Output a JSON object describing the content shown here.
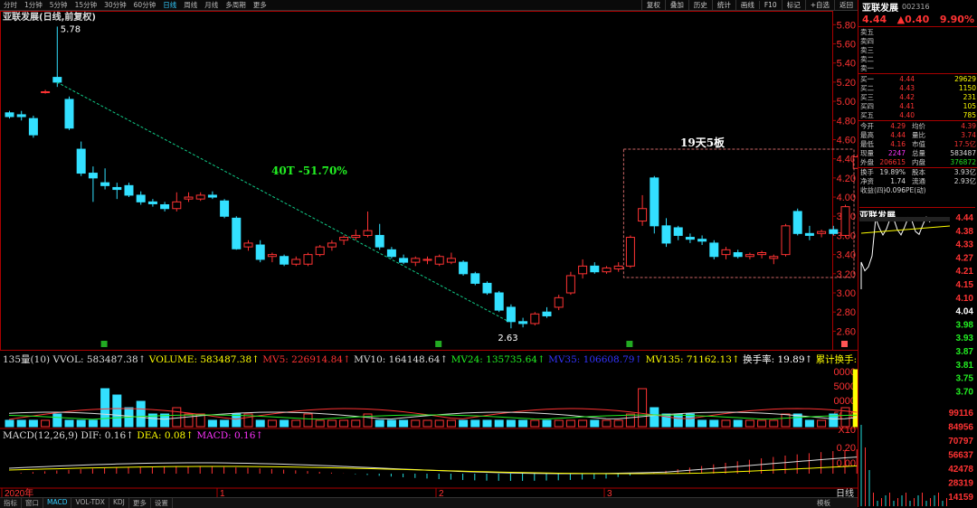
{
  "toolbar": {
    "timeframes": [
      "分时",
      "1分钟",
      "5分钟",
      "15分钟",
      "30分钟",
      "60分钟",
      "日线",
      "周线",
      "月线",
      "多周期",
      "更多"
    ],
    "active": "日线",
    "right_buttons": [
      "复权",
      "叠加",
      "历史",
      "统计",
      "画线",
      "F10",
      "标记",
      "+自选",
      "返回"
    ]
  },
  "chart_title": "亚联发展(日线,前复权)",
  "colors": {
    "up": "#ff3333",
    "down": "#33e0ff",
    "grid": "#551111",
    "axis": "#aa0000"
  },
  "annotations": {
    "high": "5.78",
    "low": "2.63",
    "trend": "40T -51.70%",
    "box": "19天5板"
  },
  "price_axis": {
    "ticks": [
      "5.80",
      "5.60",
      "5.40",
      "5.20",
      "5.00",
      "4.80",
      "4.60",
      "4.40",
      "4.20",
      "4.00",
      "3.80",
      "3.60",
      "3.40",
      "3.20",
      "3.00",
      "2.80",
      "2.60"
    ]
  },
  "chart_data": {
    "type": "candlestick",
    "ylim": [
      2.5,
      5.85
    ],
    "candles": [
      {
        "o": 4.88,
        "h": 4.9,
        "l": 4.82,
        "c": 4.84
      },
      {
        "o": 4.86,
        "h": 4.9,
        "l": 4.8,
        "c": 4.84
      },
      {
        "o": 4.82,
        "h": 4.85,
        "l": 4.62,
        "c": 4.65
      },
      {
        "o": 5.1,
        "h": 5.12,
        "l": 5.08,
        "c": 5.1
      },
      {
        "o": 5.25,
        "h": 5.78,
        "l": 5.15,
        "c": 5.2
      },
      {
        "o": 5.02,
        "h": 5.05,
        "l": 4.7,
        "c": 4.72
      },
      {
        "o": 4.5,
        "h": 4.58,
        "l": 4.22,
        "c": 4.25
      },
      {
        "o": 4.25,
        "h": 4.32,
        "l": 3.95,
        "c": 4.2
      },
      {
        "o": 4.15,
        "h": 4.3,
        "l": 4.08,
        "c": 4.12
      },
      {
        "o": 4.1,
        "h": 4.15,
        "l": 3.98,
        "c": 4.08
      },
      {
        "o": 4.12,
        "h": 4.15,
        "l": 4.0,
        "c": 4.02
      },
      {
        "o": 4.02,
        "h": 4.06,
        "l": 3.92,
        "c": 3.95
      },
      {
        "o": 3.95,
        "h": 3.98,
        "l": 3.9,
        "c": 3.93
      },
      {
        "o": 3.92,
        "h": 3.95,
        "l": 3.85,
        "c": 3.88
      },
      {
        "o": 3.88,
        "h": 4.05,
        "l": 3.85,
        "c": 3.95
      },
      {
        "o": 3.98,
        "h": 4.05,
        "l": 3.95,
        "c": 4.0
      },
      {
        "o": 3.98,
        "h": 4.05,
        "l": 3.96,
        "c": 4.02
      },
      {
        "o": 4.02,
        "h": 4.06,
        "l": 3.98,
        "c": 4.0
      },
      {
        "o": 3.96,
        "h": 3.98,
        "l": 3.78,
        "c": 3.8
      },
      {
        "o": 3.78,
        "h": 3.8,
        "l": 3.45,
        "c": 3.46
      },
      {
        "o": 3.48,
        "h": 3.55,
        "l": 3.44,
        "c": 3.52
      },
      {
        "o": 3.5,
        "h": 3.55,
        "l": 3.32,
        "c": 3.35
      },
      {
        "o": 3.38,
        "h": 3.42,
        "l": 3.32,
        "c": 3.4
      },
      {
        "o": 3.38,
        "h": 3.4,
        "l": 3.28,
        "c": 3.3
      },
      {
        "o": 3.3,
        "h": 3.38,
        "l": 3.28,
        "c": 3.35
      },
      {
        "o": 3.3,
        "h": 3.42,
        "l": 3.28,
        "c": 3.4
      },
      {
        "o": 3.4,
        "h": 3.5,
        "l": 3.38,
        "c": 3.48
      },
      {
        "o": 3.48,
        "h": 3.55,
        "l": 3.44,
        "c": 3.52
      },
      {
        "o": 3.55,
        "h": 3.6,
        "l": 3.5,
        "c": 3.58
      },
      {
        "o": 3.58,
        "h": 3.66,
        "l": 3.55,
        "c": 3.6
      },
      {
        "o": 3.6,
        "h": 3.85,
        "l": 3.58,
        "c": 3.65
      },
      {
        "o": 3.6,
        "h": 3.72,
        "l": 3.45,
        "c": 3.48
      },
      {
        "o": 3.45,
        "h": 3.48,
        "l": 3.36,
        "c": 3.38
      },
      {
        "o": 3.36,
        "h": 3.4,
        "l": 3.3,
        "c": 3.32
      },
      {
        "o": 3.32,
        "h": 3.38,
        "l": 3.28,
        "c": 3.36
      },
      {
        "o": 3.34,
        "h": 3.38,
        "l": 3.3,
        "c": 3.35
      },
      {
        "o": 3.3,
        "h": 3.4,
        "l": 3.28,
        "c": 3.38
      },
      {
        "o": 3.32,
        "h": 3.42,
        "l": 3.3,
        "c": 3.36
      },
      {
        "o": 3.32,
        "h": 3.34,
        "l": 3.18,
        "c": 3.2
      },
      {
        "o": 3.2,
        "h": 3.22,
        "l": 3.08,
        "c": 3.1
      },
      {
        "o": 3.1,
        "h": 3.12,
        "l": 2.98,
        "c": 3.0
      },
      {
        "o": 3.0,
        "h": 3.02,
        "l": 2.8,
        "c": 2.82
      },
      {
        "o": 2.85,
        "h": 2.88,
        "l": 2.63,
        "c": 2.7
      },
      {
        "o": 2.7,
        "h": 2.74,
        "l": 2.64,
        "c": 2.68
      },
      {
        "o": 2.68,
        "h": 2.8,
        "l": 2.66,
        "c": 2.78
      },
      {
        "o": 2.8,
        "h": 2.85,
        "l": 2.74,
        "c": 2.76
      },
      {
        "o": 2.85,
        "h": 2.98,
        "l": 2.82,
        "c": 2.95
      },
      {
        "o": 3.0,
        "h": 3.22,
        "l": 2.98,
        "c": 3.18
      },
      {
        "o": 3.2,
        "h": 3.35,
        "l": 3.15,
        "c": 3.28
      },
      {
        "o": 3.28,
        "h": 3.32,
        "l": 3.2,
        "c": 3.22
      },
      {
        "o": 3.22,
        "h": 3.28,
        "l": 3.2,
        "c": 3.26
      },
      {
        "o": 3.25,
        "h": 3.32,
        "l": 3.22,
        "c": 3.28
      },
      {
        "o": 3.28,
        "h": 3.6,
        "l": 3.26,
        "c": 3.58
      },
      {
        "o": 3.75,
        "h": 4.02,
        "l": 3.7,
        "c": 3.88
      },
      {
        "o": 4.2,
        "h": 4.22,
        "l": 3.62,
        "c": 3.7
      },
      {
        "o": 3.7,
        "h": 3.78,
        "l": 3.48,
        "c": 3.52
      },
      {
        "o": 3.68,
        "h": 3.7,
        "l": 3.55,
        "c": 3.6
      },
      {
        "o": 3.58,
        "h": 3.62,
        "l": 3.52,
        "c": 3.56
      },
      {
        "o": 3.56,
        "h": 3.6,
        "l": 3.5,
        "c": 3.54
      },
      {
        "o": 3.52,
        "h": 3.55,
        "l": 3.35,
        "c": 3.38
      },
      {
        "o": 3.4,
        "h": 3.48,
        "l": 3.35,
        "c": 3.45
      },
      {
        "o": 3.42,
        "h": 3.45,
        "l": 3.36,
        "c": 3.38
      },
      {
        "o": 3.38,
        "h": 3.42,
        "l": 3.35,
        "c": 3.4
      },
      {
        "o": 3.4,
        "h": 3.44,
        "l": 3.36,
        "c": 3.42
      },
      {
        "o": 3.36,
        "h": 3.4,
        "l": 3.3,
        "c": 3.38
      },
      {
        "o": 3.4,
        "h": 3.72,
        "l": 3.38,
        "c": 3.7
      },
      {
        "o": 3.85,
        "h": 3.88,
        "l": 3.6,
        "c": 3.62
      },
      {
        "o": 3.62,
        "h": 3.7,
        "l": 3.55,
        "c": 3.6
      },
      {
        "o": 3.62,
        "h": 3.66,
        "l": 3.58,
        "c": 3.64
      },
      {
        "o": 3.66,
        "h": 3.7,
        "l": 3.6,
        "c": 3.62
      },
      {
        "o": 3.6,
        "h": 3.92,
        "l": 3.58,
        "c": 3.9
      },
      {
        "o": 4.3,
        "h": 4.44,
        "l": 4.3,
        "c": 4.42
      }
    ],
    "months": [
      "2020年",
      "1",
      "2",
      "3"
    ]
  },
  "volume_panel": {
    "label": "135量(10)",
    "vvol": "VVOL: 583487.38",
    "volume": "VOLUME: 583487.38",
    "mv5": "MV5: 226914.84",
    "mv10": "MV10: 164148.64",
    "mv24": "MV24: 135735.64",
    "mv35": "MV35: 106608.79",
    "mv135": "MV135: 71162.13",
    "turnover": "换手率: 19.89",
    "cum_turnover": "累计换手:",
    "ticks": [
      "0000",
      "5000",
      "0000",
      "5000",
      "X10"
    ],
    "values": [
      1,
      1,
      1,
      1,
      2,
      1,
      1,
      1,
      6,
      5,
      3,
      4,
      2,
      2,
      3,
      2,
      2,
      1,
      1,
      2,
      2,
      1,
      1,
      1,
      1,
      2,
      1,
      1,
      1,
      1,
      2,
      1,
      1,
      1,
      1,
      1,
      1,
      1,
      1,
      1,
      1,
      1,
      1,
      1,
      1,
      1,
      1,
      1,
      1,
      1,
      1,
      1,
      2,
      6,
      3,
      2,
      2,
      2,
      1,
      1,
      1,
      1,
      1,
      1,
      1,
      2,
      2,
      1,
      1,
      2,
      3,
      9
    ]
  },
  "macd_panel": {
    "label": "MACD(12,26,9)",
    "dif": "DIF: 0.16",
    "dea": "DEA: 0.08",
    "macd": "MACD: 0.16",
    "ticks": [
      "0.20",
      "0.00"
    ]
  },
  "bottom_tabs": [
    "指标",
    "窗口",
    "MACD",
    "VOL-TDX",
    "KDJ",
    "更多",
    "设置"
  ],
  "bottom_right": "模板",
  "quote": {
    "name": "亚联发展",
    "code": "002316",
    "price": "4.44",
    "change": "▲0.40",
    "pct": "9.90%",
    "asks": [
      {
        "l": "卖五",
        "p": "",
        "v": ""
      },
      {
        "l": "卖四",
        "p": "",
        "v": ""
      },
      {
        "l": "卖三",
        "p": "",
        "v": ""
      },
      {
        "l": "卖二",
        "p": "",
        "v": ""
      },
      {
        "l": "卖一",
        "p": "",
        "v": ""
      }
    ],
    "bids": [
      {
        "l": "买一",
        "p": "4.44",
        "v": "29629"
      },
      {
        "l": "买二",
        "p": "4.43",
        "v": "1150"
      },
      {
        "l": "买三",
        "p": "4.42",
        "v": "231"
      },
      {
        "l": "买四",
        "p": "4.41",
        "v": "105"
      },
      {
        "l": "买五",
        "p": "4.40",
        "v": "785"
      }
    ],
    "stats1": [
      {
        "a": "今开",
        "b": "4.29",
        "c": "均价",
        "d": "4.39"
      },
      {
        "a": "最高",
        "b": "4.44",
        "c": "量比",
        "d": "3.74"
      },
      {
        "a": "最低",
        "b": "4.16",
        "c": "市值",
        "d": "17.5亿"
      },
      {
        "a": "现量",
        "b": "2247",
        "c": "总量",
        "d": "583487"
      },
      {
        "a": "外盘",
        "b": "206615",
        "c": "内盘",
        "d": "376872"
      }
    ],
    "stats2": [
      {
        "a": "换手",
        "b": "19.89%",
        "c": "股本",
        "d": "3.93亿"
      },
      {
        "a": "净资",
        "b": "1.74",
        "c": "流通",
        "d": "2.93亿"
      },
      {
        "a": "收益(四)",
        "b": "-0.096",
        "c": "PE(动)",
        "d": ""
      }
    ],
    "mini_title": "亚联发展",
    "mini_levels": [
      "4.44",
      "4.38",
      "4.33",
      "4.27",
      "4.21",
      "4.15",
      "4.10",
      "4.04",
      "3.98",
      "3.93",
      "3.87",
      "3.81",
      "3.75",
      "3.70"
    ],
    "mini_vol": [
      "99116",
      "84956",
      "70797",
      "56637",
      "42478",
      "28319",
      "14159"
    ],
    "mini_tab": "日线"
  }
}
